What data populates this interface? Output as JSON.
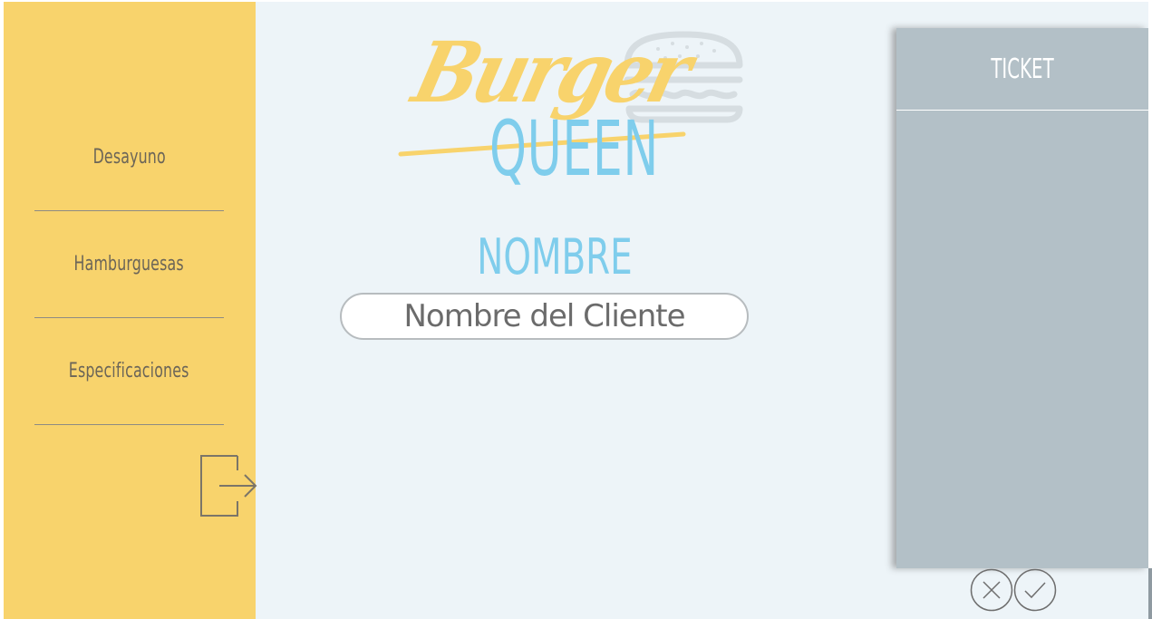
{
  "sidebar": {
    "items": [
      {
        "label": "Desayuno"
      },
      {
        "label": "Hamburguesas"
      },
      {
        "label": "Especificaciones"
      }
    ],
    "logout_icon": "logout-icon"
  },
  "logo": {
    "line1": "Burger",
    "line2": "QUEEN",
    "icon": "burger-icon"
  },
  "form": {
    "title": "NOMBRE",
    "name_placeholder": "Nombre del Cliente"
  },
  "ticket": {
    "title": "TICKET",
    "cancel_icon": "close-icon",
    "confirm_icon": "check-icon"
  },
  "colors": {
    "sidebar_bg": "#f8d36c",
    "page_bg": "#edf4f8",
    "accent_blue": "#7fcdec",
    "ticket_bg": "#b3c0c7",
    "text_dark": "#6b6558"
  }
}
